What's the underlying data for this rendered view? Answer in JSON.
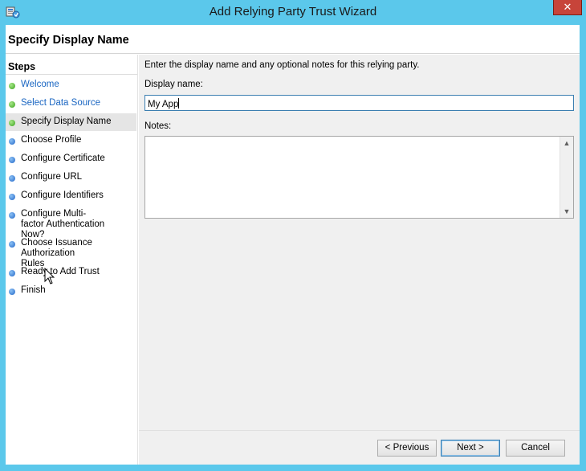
{
  "window": {
    "title": "Add Relying Party Trust Wizard",
    "close_glyph": "✕",
    "header_title": "Specify Display Name"
  },
  "steps": {
    "heading": "Steps",
    "items": [
      {
        "label": "Welcome",
        "state": "done"
      },
      {
        "label": "Select Data Source",
        "state": "done"
      },
      {
        "label": "Specify Display Name",
        "state": "current"
      },
      {
        "label": "Choose Profile",
        "state": "pending"
      },
      {
        "label": "Configure Certificate",
        "state": "pending"
      },
      {
        "label": "Configure URL",
        "state": "pending"
      },
      {
        "label": "Configure Identifiers",
        "state": "pending"
      },
      {
        "label": "Configure Multi-factor Authentication Now?",
        "state": "pending"
      },
      {
        "label": "Choose Issuance Authorization Rules",
        "state": "pending"
      },
      {
        "label": "Ready to Add Trust",
        "state": "pending"
      },
      {
        "label": "Finish",
        "state": "pending"
      }
    ]
  },
  "form": {
    "instruction": "Enter the display name and any optional notes for this relying party.",
    "display_name_label": "Display name:",
    "display_name_value": "My App",
    "notes_label": "Notes:",
    "notes_value": ""
  },
  "buttons": {
    "previous": "< Previous",
    "next": "Next >",
    "cancel": "Cancel"
  },
  "colors": {
    "titlebar": "#5bc8eb",
    "done_step": "#1a66c2",
    "focus_border": "#3c7fb1"
  },
  "icons": {
    "app": "relying-party-wizard-icon",
    "done_step": "green-dot-icon",
    "pending_step": "blue-dot-icon"
  }
}
